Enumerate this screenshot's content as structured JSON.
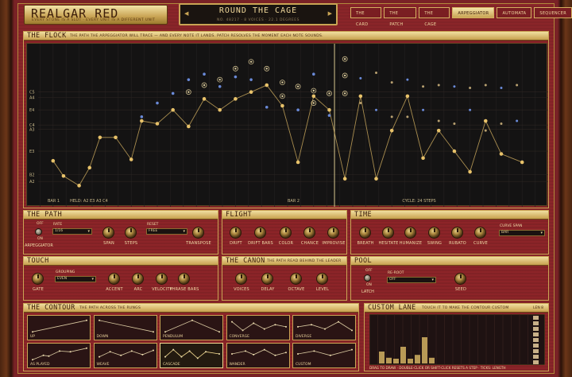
{
  "header": {
    "title": "REALGAR RED",
    "subtitle": "EVERY STONE IS A SLOT · EVERY UNIT IS A DIFFERENT UNIT",
    "patch_name": "ROUND THE CAGE",
    "patch_meta": "NO. 48217 · 8 VOICES · 22.1 DEGREES",
    "prev": "◀",
    "next": "▶",
    "tabs": [
      {
        "label": "THE CARD",
        "active": false
      },
      {
        "label": "THE PATCH",
        "active": false
      },
      {
        "label": "THE CAGE",
        "active": false
      },
      {
        "label": "ARPEGGIATOR",
        "active": true
      },
      {
        "label": "AUTOMATA",
        "active": false
      },
      {
        "label": "SEQUENCER",
        "active": false
      }
    ]
  },
  "flock": {
    "title": "THE FLOCK",
    "subtitle": "THE PATH THE ARPEGGIATOR WILL TRACE — AND EVERY NOTE IT LANDS. PATCH RESOLVES THE MOMENT EACH NOTE SOUNDS.",
    "y_labels": [
      "C5",
      "A4",
      "E4",
      "C4",
      "A3",
      "E3",
      "B2",
      "A2"
    ],
    "bar1": "BAR 1",
    "held": "HELD: A2 E3 A3 C4",
    "bar2": "BAR 2",
    "cycle": "CYCLE: 24 STEPS",
    "path": [
      [
        0.05,
        0.23
      ],
      [
        0.07,
        0.12
      ],
      [
        0.1,
        0.05
      ],
      [
        0.12,
        0.18
      ],
      [
        0.14,
        0.4
      ],
      [
        0.17,
        0.4
      ],
      [
        0.2,
        0.24
      ],
      [
        0.22,
        0.52
      ],
      [
        0.25,
        0.5
      ],
      [
        0.28,
        0.6
      ],
      [
        0.31,
        0.48
      ],
      [
        0.34,
        0.68
      ],
      [
        0.37,
        0.6
      ],
      [
        0.4,
        0.68
      ],
      [
        0.43,
        0.73
      ],
      [
        0.46,
        0.78
      ],
      [
        0.49,
        0.63
      ],
      [
        0.52,
        0.22
      ],
      [
        0.55,
        0.7
      ],
      [
        0.58,
        0.6
      ],
      [
        0.61,
        0.1
      ],
      [
        0.64,
        0.7
      ],
      [
        0.67,
        0.1
      ],
      [
        0.7,
        0.45
      ],
      [
        0.73,
        0.7
      ],
      [
        0.76,
        0.25
      ],
      [
        0.79,
        0.45
      ],
      [
        0.82,
        0.3
      ],
      [
        0.85,
        0.15
      ],
      [
        0.88,
        0.52
      ],
      [
        0.91,
        0.28
      ],
      [
        0.95,
        0.22
      ]
    ],
    "gold_rings": [
      [
        0.37,
        0.82
      ],
      [
        0.4,
        0.9
      ],
      [
        0.43,
        0.95
      ],
      [
        0.46,
        0.9
      ],
      [
        0.49,
        0.8
      ],
      [
        0.34,
        0.78
      ],
      [
        0.31,
        0.73
      ],
      [
        0.52,
        0.77
      ],
      [
        0.55,
        0.74
      ],
      [
        0.58,
        0.72
      ],
      [
        0.61,
        0.72
      ],
      [
        0.61,
        0.85
      ],
      [
        0.61,
        0.97
      ],
      [
        0.55,
        0.65
      ],
      [
        0.49,
        0.7
      ]
    ],
    "blue_rings": [
      [
        0.28,
        0.72
      ],
      [
        0.31,
        0.82
      ],
      [
        0.34,
        0.86
      ],
      [
        0.37,
        0.77
      ],
      [
        0.4,
        0.84
      ],
      [
        0.43,
        0.82
      ],
      [
        0.25,
        0.65
      ],
      [
        0.22,
        0.55
      ],
      [
        0.46,
        0.62
      ],
      [
        0.52,
        0.6
      ],
      [
        0.55,
        0.86
      ],
      [
        0.58,
        0.56
      ]
    ],
    "sparks": [
      [
        0.64,
        0.83
      ],
      [
        0.67,
        0.87
      ],
      [
        0.7,
        0.8
      ],
      [
        0.73,
        0.82
      ],
      [
        0.76,
        0.77
      ],
      [
        0.79,
        0.78
      ],
      [
        0.82,
        0.77
      ],
      [
        0.85,
        0.76
      ],
      [
        0.88,
        0.78
      ],
      [
        0.91,
        0.76
      ],
      [
        0.94,
        0.78
      ],
      [
        0.64,
        0.65
      ],
      [
        0.67,
        0.6
      ],
      [
        0.7,
        0.55
      ],
      [
        0.73,
        0.55
      ],
      [
        0.76,
        0.6
      ],
      [
        0.79,
        0.52
      ],
      [
        0.82,
        0.5
      ],
      [
        0.85,
        0.6
      ],
      [
        0.88,
        0.45
      ],
      [
        0.91,
        0.5
      ],
      [
        0.94,
        0.52
      ]
    ]
  },
  "path_panel": {
    "title": "THE PATH",
    "arp": "ARPEGGIATOR",
    "off": "OFF",
    "on": "ON",
    "rate_label": "RATE",
    "rate": "1/16",
    "reset_label": "RESET",
    "reset": "FREE",
    "knobs": [
      "SPAN",
      "STEPS",
      "TRANSPOSE"
    ]
  },
  "flight": {
    "title": "FLIGHT",
    "knobs": [
      "DRIFT",
      "DRIFT BARS",
      "COLOR",
      "CHANCE",
      "IMPROVISE"
    ]
  },
  "time": {
    "title": "TIME",
    "knobs": [
      "BREATH",
      "HESITATE",
      "HUMANIZE",
      "SWING",
      "RUBATO",
      "CURVE"
    ],
    "span_label": "CURVE SPAN",
    "span": "BAR"
  },
  "touch": {
    "title": "TOUCH",
    "grouping_label": "GROUPING",
    "grouping": "EVEN",
    "knobs": [
      "GATE",
      "ACCENT",
      "ARC",
      "VELOCITY",
      "PHRASE BARS"
    ]
  },
  "canon": {
    "title": "THE CANON",
    "subtitle": "THE PATH READ BEHIND THE LEADER",
    "knobs": [
      "VOICES",
      "DELAY",
      "OCTAVE",
      "LEVEL"
    ]
  },
  "pool": {
    "title": "POOL",
    "off": "OFF",
    "on": "ON",
    "latch": "LATCH",
    "reroot_label": "RE-ROOT",
    "reroot": "OFF",
    "knobs": [
      "SEED"
    ]
  },
  "contour": {
    "title": "THE CONTOUR",
    "subtitle": "THE PATH ACROSS THE RUNGS",
    "cells": [
      {
        "name": "UP",
        "on": false,
        "pts": [
          [
            0,
            0.9
          ],
          [
            1,
            0.1
          ]
        ]
      },
      {
        "name": "DOWN",
        "on": false,
        "pts": [
          [
            0,
            0.1
          ],
          [
            1,
            0.9
          ]
        ]
      },
      {
        "name": "PENDULUM",
        "on": false,
        "pts": [
          [
            0,
            0.9
          ],
          [
            0.5,
            0.1
          ],
          [
            1,
            0.9
          ]
        ]
      },
      {
        "name": "CONVERGE",
        "on": false,
        "pts": [
          [
            0,
            0.2
          ],
          [
            0.2,
            0.8
          ],
          [
            0.4,
            0.3
          ],
          [
            0.6,
            0.7
          ],
          [
            0.8,
            0.4
          ],
          [
            1,
            0.55
          ]
        ]
      },
      {
        "name": "DIVERGE",
        "on": false,
        "pts": [
          [
            0,
            0.55
          ],
          [
            0.25,
            0.4
          ],
          [
            0.5,
            0.7
          ],
          [
            0.75,
            0.2
          ],
          [
            1,
            0.8
          ]
        ]
      },
      {
        "name": "AS PLAYED",
        "on": false,
        "pts": [
          [
            0,
            0.9
          ],
          [
            0.2,
            0.6
          ],
          [
            0.3,
            0.65
          ],
          [
            0.5,
            0.3
          ],
          [
            0.7,
            0.35
          ],
          [
            1,
            0.1
          ]
        ]
      },
      {
        "name": "WEAVE",
        "on": false,
        "pts": [
          [
            0,
            0.7
          ],
          [
            0.2,
            0.35
          ],
          [
            0.4,
            0.6
          ],
          [
            0.6,
            0.3
          ],
          [
            0.8,
            0.55
          ],
          [
            1,
            0.25
          ]
        ]
      },
      {
        "name": "CASCADE",
        "on": true,
        "pts": [
          [
            0,
            0.7
          ],
          [
            0.15,
            0.2
          ],
          [
            0.3,
            0.7
          ],
          [
            0.45,
            0.3
          ],
          [
            0.6,
            0.8
          ],
          [
            0.75,
            0.35
          ],
          [
            1,
            0.5
          ]
        ]
      },
      {
        "name": "WANDER",
        "on": false,
        "pts": [
          [
            0,
            0.5
          ],
          [
            0.25,
            0.3
          ],
          [
            0.4,
            0.55
          ],
          [
            0.6,
            0.2
          ],
          [
            0.8,
            0.6
          ],
          [
            1,
            0.4
          ]
        ]
      },
      {
        "name": "CUSTOM",
        "on": false,
        "pts": [
          [
            0,
            0.5
          ],
          [
            0.3,
            0.3
          ],
          [
            0.6,
            0.6
          ],
          [
            1,
            0.2
          ]
        ]
      }
    ]
  },
  "lane": {
    "title": "CUSTOM LANE",
    "subtitle": "TOUCH IT TO MAKE THE CONTOUR CUSTOM",
    "len": "LEN 8",
    "bars": [
      0.25,
      0.12,
      0.1,
      0.35,
      0.1,
      0.18,
      0.55,
      0.12
    ],
    "hint": "DRAG TO DRAW · DOUBLE-CLICK OR SHIFT-CLICK RESETS A STEP · TICKS: LENGTH"
  },
  "colors": {
    "gold": "#e8c26a",
    "blue": "#6a8ad8",
    "wine": "#8c2428"
  }
}
